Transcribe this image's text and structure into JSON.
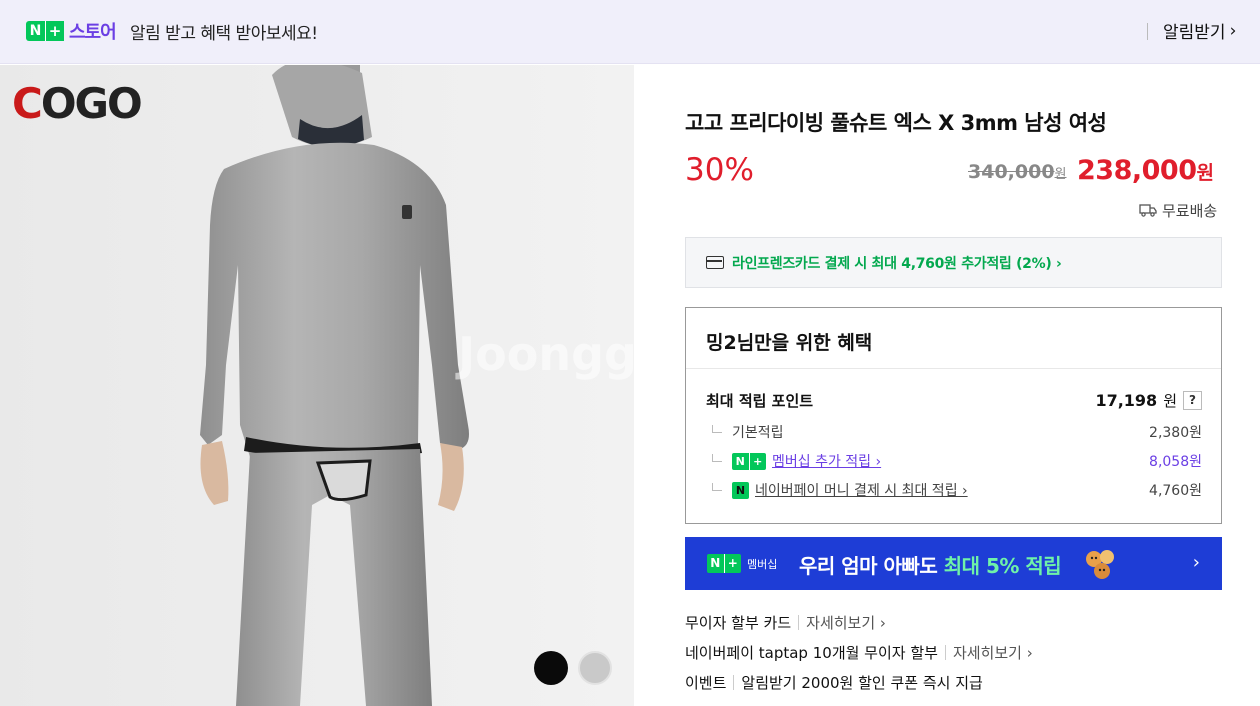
{
  "topbar": {
    "badge_n": "N",
    "badge_plus": "+",
    "store_label": "스토어",
    "message": "알림 받고 혜택 받아보세요!",
    "alert_button": "알림받기",
    "alert_chevron": "›"
  },
  "image": {
    "brand_prefix": "C",
    "brand_rest": "OGO",
    "watermark": "Joongg",
    "swatches": [
      "black",
      "gray"
    ]
  },
  "product": {
    "title": "고고 프리다이빙 풀슈트 엑스 X 3mm 남성 여성",
    "discount": "30%",
    "original_price": "340,000",
    "original_unit": "원",
    "sale_price": "238,000",
    "sale_unit": "원",
    "shipping": "무료배송"
  },
  "card_offer": {
    "text": "라인프렌즈카드 결제 시 최대 4,760원 추가적립 (2%) ›"
  },
  "benefit": {
    "heading": "밍2님만을 위한 혜택",
    "max_points_label": "최대 적립 포인트",
    "max_points_value": "17,198",
    "max_points_unit": "원",
    "help": "?",
    "rows": [
      {
        "label": "기본적립",
        "value": "2,380원"
      },
      {
        "label": "멤버십 추가 적립 ›",
        "value": "8,058원"
      },
      {
        "label": "네이버페이 머니 결제 시 최대 적립 ›",
        "value": "4,760원"
      }
    ],
    "np_n": "N",
    "np_plus": "+",
    "pay_icon": "N"
  },
  "banner": {
    "badge_n": "N",
    "badge_plus": "+",
    "badge_text": "멤버십",
    "msg_prefix": "우리 엄마 아빠도 ",
    "msg_highlight": "최대 5% 적립",
    "chevron": "›"
  },
  "info": [
    {
      "label": "무이자 할부 카드",
      "more": "자세히보기 ›"
    },
    {
      "label": "네이버페이 taptap 10개월 무이자 할부",
      "more": "자세히보기 ›"
    },
    {
      "label": "이벤트",
      "more": "알림받기 2000원 할인 쿠폰 즉시 지급"
    }
  ],
  "colors": {
    "brand_purple": "#6b3fe4",
    "naver_green": "#03c75a",
    "price_red": "#e01e2c",
    "banner_blue": "#1e3dd6"
  }
}
